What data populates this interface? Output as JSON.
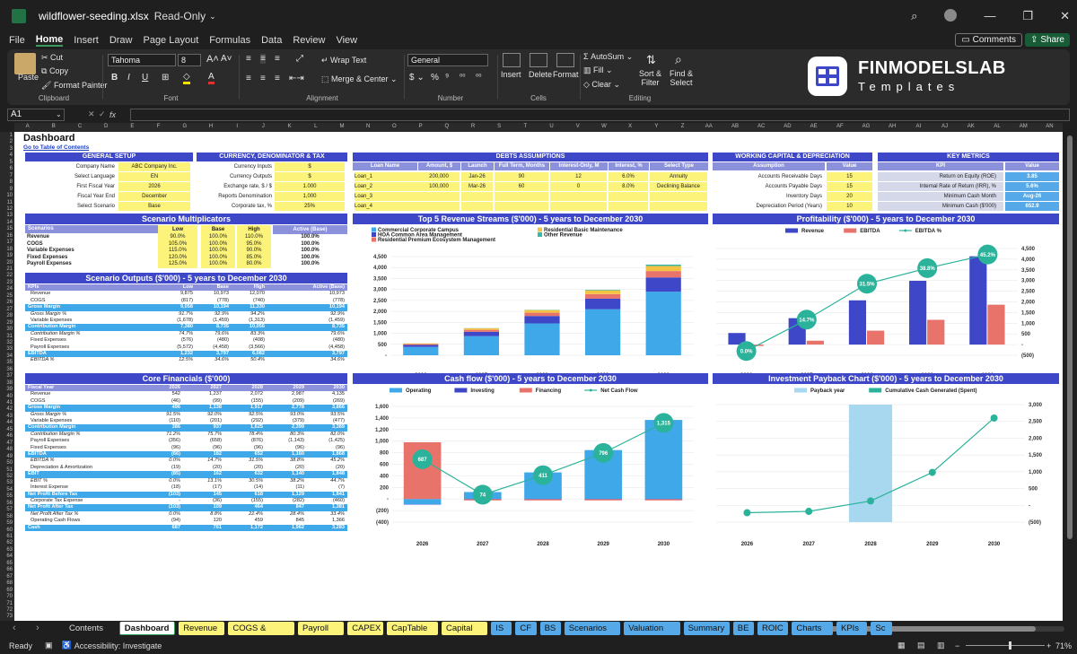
{
  "window": {
    "file_name": "wildflower-seeding.xlsx",
    "mode": "Read-Only"
  },
  "menu": {
    "tabs": [
      "File",
      "Home",
      "Insert",
      "Draw",
      "Page Layout",
      "Formulas",
      "Data",
      "Review",
      "View"
    ],
    "comments": "Comments",
    "share": "Share"
  },
  "ribbon": {
    "paste": "Paste",
    "cut": "Cut",
    "copy": "Copy",
    "format_painter": "Format Painter",
    "clipboard": "Clipboard",
    "font_name": "Tahoma",
    "font_size": "8",
    "font": "Font",
    "wrap_text": "Wrap Text",
    "merge_center": "Merge & Center",
    "alignment": "Alignment",
    "number_format": "General",
    "number": "Number",
    "insert": "Insert",
    "delete": "Delete",
    "format": "Format",
    "cells": "Cells",
    "autosum": "AutoSum",
    "fill": "Fill",
    "clear": "Clear",
    "sort_filter": "Sort &",
    "sort_filter2": "Filter",
    "find_select": "Find &",
    "find_select2": "Select",
    "editing": "Editing"
  },
  "brand": {
    "line1": "FINMODELSLAB",
    "line2": "Templates"
  },
  "formula_bar": {
    "cell_ref": "A1",
    "fx": "fx"
  },
  "columns": [
    "A",
    "B",
    "C",
    "D",
    "E",
    "F",
    "G",
    "H",
    "I",
    "J",
    "K",
    "L",
    "M",
    "N",
    "O",
    "P",
    "Q",
    "R",
    "S",
    "T",
    "U",
    "V",
    "W",
    "X",
    "Y",
    "Z",
    "AA",
    "AB",
    "AC",
    "AD",
    "AE",
    "AF",
    "AG",
    "AH",
    "AI",
    "AJ",
    "AK",
    "AL",
    "AM",
    "AN"
  ],
  "sheet": {
    "title": "Dashboard",
    "toc_link": "Go to Table of Contents",
    "general_setup": {
      "title": "GENERAL SETUP",
      "rows": [
        [
          "Company Name",
          "ABC Company Inc."
        ],
        [
          "Select Language",
          "EN"
        ],
        [
          "First Fiscal Year",
          "2026"
        ],
        [
          "Fiscal Year End",
          "December"
        ],
        [
          "Select Scenario",
          "Base"
        ]
      ]
    },
    "currency": {
      "title": "CURRENCY, DENOMINATOR & TAX",
      "rows": [
        [
          "Currency Inputs",
          "$"
        ],
        [
          "Currency Outputs",
          "$"
        ],
        [
          "Exchange rate, $ / $",
          "1.000"
        ],
        [
          "Reports Denomination",
          "1,000"
        ],
        [
          "Corporate tax, %",
          "25%"
        ]
      ]
    },
    "debts": {
      "title": "DEBTS ASSUMPTIONS",
      "headers": [
        "Loan Name",
        "Amount, $",
        "Launch",
        "Full Term, Months",
        "Interest-Only, M",
        "Interest, %",
        "Select Type"
      ],
      "rows": [
        [
          "Loan_1",
          "200,000",
          "Jan-26",
          "90",
          "12",
          "6.0%",
          "Annuity"
        ],
        [
          "Loan_2",
          "100,000",
          "Mar-26",
          "60",
          "0",
          "8.0%",
          "Declining Balance"
        ],
        [
          "Loan_3",
          "",
          "",
          "",
          "",
          "",
          ""
        ],
        [
          "Loan_4",
          "",
          "",
          "",
          "",
          "",
          ""
        ]
      ]
    },
    "working_capital": {
      "title": "WORKING CAPITAL & DEPRECIATION",
      "headers": [
        "Assumption",
        "Value"
      ],
      "rows": [
        [
          "Accounts Receivable Days",
          "15"
        ],
        [
          "Accounts Payable Days",
          "15"
        ],
        [
          "Inventory Days",
          "20"
        ],
        [
          "Depreciation Period (Years)",
          "10"
        ]
      ]
    },
    "key_metrics": {
      "title": "KEY METRICS",
      "headers": [
        "KPI",
        "Value"
      ],
      "rows": [
        [
          "Return on Equity (ROE)",
          "3.85"
        ],
        [
          "Internal Rate of Return (IRR), %",
          "5.6%"
        ],
        [
          "Minimum Cash Month",
          "Aug-26"
        ],
        [
          "Minimum Cash ($'000)",
          "652.9"
        ]
      ]
    },
    "scenario_mult": {
      "title": "Scenario Multiplicators",
      "headers": [
        "Scenarios",
        "Low",
        "Base",
        "High",
        "Active (Base)"
      ],
      "rows": [
        [
          "Revenue",
          "90.0%",
          "100.0%",
          "110.0%",
          "100.0%"
        ],
        [
          "COGS",
          "105.0%",
          "100.0%",
          "95.0%",
          "100.0%"
        ],
        [
          "Variable Expenses",
          "115.0%",
          "100.0%",
          "90.0%",
          "100.0%"
        ],
        [
          "Fixed Expenses",
          "120.0%",
          "100.0%",
          "85.0%",
          "100.0%"
        ],
        [
          "Payroll Expenses",
          "125.0%",
          "100.0%",
          "80.0%",
          "100.0%"
        ]
      ]
    },
    "scenario_out": {
      "title": "Scenario Outputs ($'000) - 5 years to December 2030",
      "headers": [
        "KPIs",
        "Low",
        "Base",
        "High",
        "Active (Base)"
      ],
      "rows": [
        [
          "Revenue",
          "9,875",
          "10,973",
          "12,070",
          "10,973",
          ""
        ],
        [
          "COGS",
          "(817)",
          "(778)",
          "(740)",
          "(778)",
          ""
        ],
        [
          "Gross Margin",
          "9,058",
          "10,194",
          "11,330",
          "10,194",
          "hl"
        ],
        [
          "Gross Margin %",
          "91.7%",
          "92.9%",
          "94.2%",
          "92.9%",
          "it"
        ],
        [
          "Variable Expenses",
          "(1,678)",
          "(1,459)",
          "(1,313)",
          "(1,459)",
          ""
        ],
        [
          "Contribution Margin",
          "7,380",
          "8,735",
          "10,056",
          "8,735",
          "hl"
        ],
        [
          "Contribution Margin %",
          "74.7%",
          "79.6%",
          "83.3%",
          "79.6%",
          "it"
        ],
        [
          "Fixed Expenses",
          "(576)",
          "(480)",
          "(408)",
          "(480)",
          ""
        ],
        [
          "Payroll Expenses",
          "(5,572)",
          "(4,458)",
          "(3,566)",
          "(4,458)",
          ""
        ],
        [
          "EBITDA",
          "1,232",
          "3,797",
          "6,082",
          "3,797",
          "hl"
        ],
        [
          "EBITDA %",
          "12.5%",
          "34.6%",
          "50.4%",
          "34.6%",
          "it"
        ]
      ]
    },
    "core": {
      "title": "Core Financials ($'000)",
      "headers": [
        "Fiscal Year",
        "2026",
        "2027",
        "2028",
        "2029",
        "2030"
      ],
      "rows": [
        [
          "Revenue",
          "542",
          "1,237",
          "2,072",
          "2,987",
          "4,135",
          ""
        ],
        [
          "COGS",
          "(46)",
          "(99)",
          "(155)",
          "(209)",
          "(269)",
          ""
        ],
        [
          "Gross Margin",
          "496",
          "1,138",
          "1,917",
          "2,778",
          "3,866",
          "hl"
        ],
        [
          "Gross Margin %",
          "91.5%",
          "92.0%",
          "92.5%",
          "93.0%",
          "93.5%",
          "it"
        ],
        [
          "Variable Expenses",
          "(110)",
          "(201)",
          "(292)",
          "(379)",
          "(477)",
          ""
        ],
        [
          "Contribution Margin",
          "386",
          "937",
          "1,625",
          "2,399",
          "3,389",
          "hl"
        ],
        [
          "Contribution Margin %",
          "71.2%",
          "75.7%",
          "78.4%",
          "80.3%",
          "82.0%",
          "it"
        ],
        [
          "Payroll Expenses",
          "(356)",
          "(658)",
          "(876)",
          "(1,143)",
          "(1,425)",
          ""
        ],
        [
          "Fixed Expenses",
          "(96)",
          "(96)",
          "(96)",
          "(96)",
          "(96)",
          ""
        ],
        [
          "EBITDA",
          "(66)",
          "182",
          "652",
          "1,160",
          "1,868",
          "hl"
        ],
        [
          "EBITDA %",
          "0.0%",
          "14.7%",
          "31.5%",
          "38.8%",
          "45.2%",
          "it"
        ],
        [
          "Depreciation & Amortization",
          "(19)",
          "(20)",
          "(20)",
          "(20)",
          "(20)",
          ""
        ],
        [
          "EBIT",
          "(85)",
          "162",
          "632",
          "1,140",
          "1,848",
          "hl"
        ],
        [
          "EBIT %",
          "0.0%",
          "13.1%",
          "30.5%",
          "38.2%",
          "44.7%",
          "it"
        ],
        [
          "Interest Expense",
          "(18)",
          "(17)",
          "(14)",
          "(11)",
          "(7)",
          ""
        ],
        [
          "Net Profit Before Tax",
          "(103)",
          "145",
          "618",
          "1,129",
          "1,841",
          "hl"
        ],
        [
          "Corporate Tax Expense",
          "-",
          "(36)",
          "(155)",
          "(282)",
          "(460)",
          ""
        ],
        [
          "Net Profit After Tax",
          "(103)",
          "109",
          "464",
          "847",
          "1,381",
          "hl"
        ],
        [
          "Net Profit After Tax %",
          "0.0%",
          "8.8%",
          "22.4%",
          "28.4%",
          "33.4%",
          "it"
        ],
        [
          "Operating Cash Flows",
          "(94)",
          "120",
          "459",
          "845",
          "1,366",
          ""
        ],
        [
          "Cash",
          "687",
          "761",
          "1,172",
          "1,962",
          "3,283",
          "hl"
        ]
      ]
    }
  },
  "chart_data": [
    {
      "type": "bar",
      "title": "Top 5 Revenue Streams ($'000) - 5 years to December 2030",
      "categories": [
        "2026",
        "2027",
        "2028",
        "2029",
        "2030"
      ],
      "series": [
        {
          "name": "Commercial Corporate Campus",
          "color": "#3fa8e8",
          "values": [
            380,
            870,
            1450,
            2100,
            2900
          ]
        },
        {
          "name": "HOA Common Area Management",
          "color": "#3e47c8",
          "values": [
            90,
            200,
            340,
            480,
            650
          ]
        },
        {
          "name": "Residential Premium Ecosystem Management",
          "color": "#e8736b",
          "values": [
            40,
            90,
            150,
            210,
            290
          ]
        },
        {
          "name": "Residential Basic Maintenance",
          "color": "#f5c344",
          "values": [
            30,
            70,
            120,
            170,
            230
          ]
        },
        {
          "name": "Other Revenue",
          "color": "#3cb8a8",
          "values": [
            2,
            7,
            12,
            27,
            65
          ]
        }
      ],
      "yticks": [
        "-",
        "500",
        "1,000",
        "1,500",
        "2,000",
        "2,500",
        "3,000",
        "3,500",
        "4,000",
        "4,500"
      ],
      "ylim": [
        0,
        4500
      ]
    },
    {
      "type": "bar",
      "title": "Profitability ($'000) - 5 years to December 2030",
      "categories": [
        "2026",
        "2027",
        "2028",
        "2029",
        "2030"
      ],
      "series": [
        {
          "name": "Revenue",
          "color": "#3e47c8",
          "values": [
            542,
            1237,
            2072,
            2987,
            4135
          ]
        },
        {
          "name": "EBITDA",
          "color": "#e8736b",
          "values": [
            -66,
            182,
            652,
            1160,
            1868
          ]
        },
        {
          "name": "EBITDA %",
          "color": "#2ab39a",
          "type": "line",
          "values": [
            0.0,
            14.7,
            31.5,
            38.8,
            45.2
          ],
          "labels": [
            "0.0%",
            "14.7%",
            "31.5%",
            "38.8%",
            "45.2%"
          ]
        }
      ],
      "yticks": [
        "(500)",
        "-",
        "500",
        "1,000",
        "1,500",
        "2,000",
        "2,500",
        "3,000",
        "3,500",
        "4,000",
        "4,500"
      ],
      "ylim": [
        -500,
        4500
      ]
    },
    {
      "type": "bar",
      "title": "Cash flow ($'000) - 5 years to December 2030",
      "categories": [
        "2026",
        "2027",
        "2028",
        "2029",
        "2030"
      ],
      "series": [
        {
          "name": "Operating",
          "color": "#3fa8e8",
          "values": [
            -94,
            120,
            459,
            845,
            1366
          ]
        },
        {
          "name": "Investing",
          "color": "#3e47c8",
          "values": [
            -5,
            -5,
            -5,
            -5,
            -5
          ]
        },
        {
          "name": "Financing",
          "color": "#e8736b",
          "values": [
            980,
            -20,
            -20,
            -20,
            -20
          ]
        },
        {
          "name": "Net Cash Flow",
          "color": "#2ab39a",
          "type": "line",
          "values": [
            687,
            74,
            411,
            796,
            1315
          ],
          "labels": [
            "687",
            "74",
            "411",
            "796",
            "1,315"
          ]
        }
      ],
      "yticks": [
        "(400)",
        "(200)",
        "-",
        "200",
        "400",
        "600",
        "800",
        "1,000",
        "1,200",
        "1,400",
        "1,600"
      ],
      "ylim": [
        -400,
        1600
      ]
    },
    {
      "type": "line",
      "title": "Investment Payback Chart ($'000) - 5 years to December 2030",
      "categories": [
        "2026",
        "2027",
        "2028",
        "2029",
        "2030"
      ],
      "series": [
        {
          "name": "Payback year",
          "color": "#a8d8f0",
          "type": "band",
          "values": [
            0,
            0,
            1,
            0,
            0
          ]
        },
        {
          "name": "Cumulative Cash Generated (Spent)",
          "color": "#2ab39a",
          "values": [
            -220,
            -180,
            130,
            980,
            2600
          ]
        }
      ],
      "yticks": [
        "(500)",
        "-",
        "500",
        "1,000",
        "1,500",
        "2,000",
        "2,500",
        "3,000"
      ],
      "ylim": [
        -500,
        3000
      ]
    }
  ],
  "sheet_tabs": [
    [
      "Contents",
      "#1f1f1f",
      "#ddd"
    ],
    [
      "Dashboard",
      "#fff",
      "#111"
    ],
    [
      "Revenue",
      "#fbf37a",
      "#111"
    ],
    [
      "COGS & OPEX",
      "#fbf37a",
      "#111"
    ],
    [
      "Payroll",
      "#fbf37a",
      "#111"
    ],
    [
      "CAPEX",
      "#fbf37a",
      "#111"
    ],
    [
      "CapTable",
      "#fbf37a",
      "#111"
    ],
    [
      "Capital",
      "#fbf37a",
      "#111"
    ],
    [
      "IS",
      "#56a9e8",
      "#111"
    ],
    [
      "CF",
      "#56a9e8",
      "#111"
    ],
    [
      "BS",
      "#56a9e8",
      "#111"
    ],
    [
      "Scenarios",
      "#56a9e8",
      "#111"
    ],
    [
      "Valuation",
      "#56a9e8",
      "#111"
    ],
    [
      "Summary",
      "#56a9e8",
      "#111"
    ],
    [
      "BE",
      "#56a9e8",
      "#111"
    ],
    [
      "ROIC",
      "#56a9e8",
      "#111"
    ],
    [
      "Charts",
      "#56a9e8",
      "#111"
    ],
    [
      "KPIs",
      "#56a9e8",
      "#111"
    ],
    [
      "Sc",
      "#56a9e8",
      "#111"
    ]
  ],
  "status": {
    "ready": "Ready",
    "accessibility": "Accessibility: Investigate",
    "zoom": "71%"
  }
}
